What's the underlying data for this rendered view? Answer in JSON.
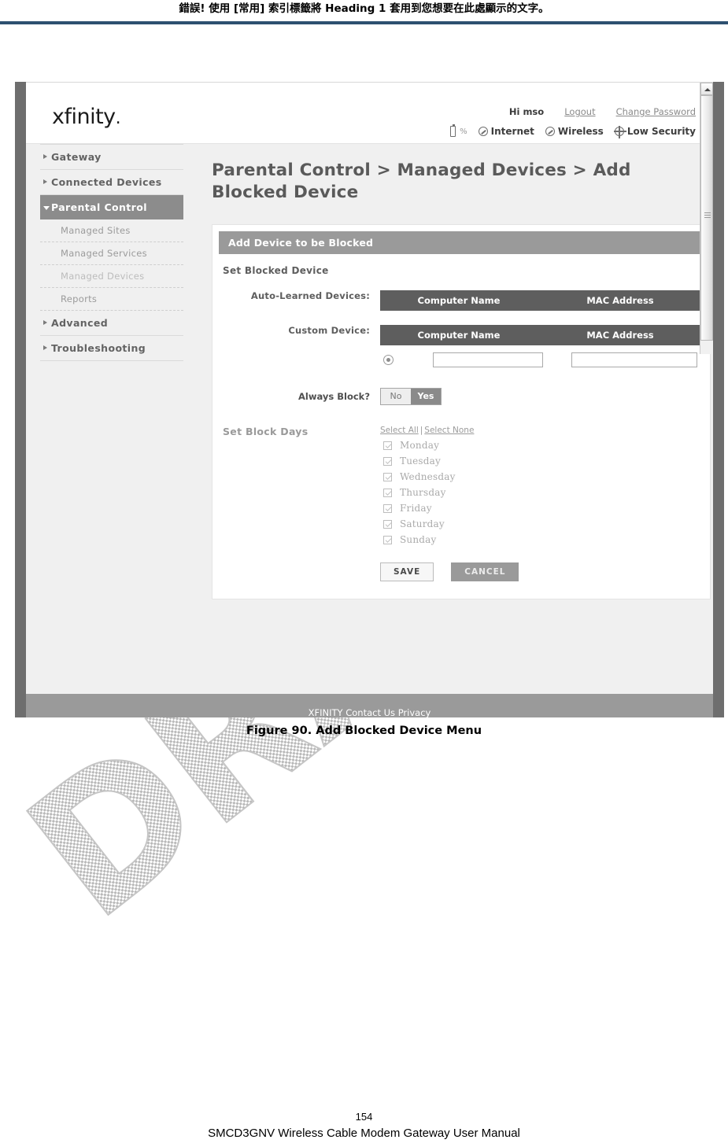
{
  "document": {
    "header_error_text": "錯誤! 使用 [常用] 索引標籤將 Heading 1 套用到您想要在此處顯示的文字。",
    "caption": "Figure 90. Add Blocked Device Menu",
    "page_number": "154",
    "footer_title": "SMCD3GNV Wireless Cable Modem Gateway User Manual",
    "watermark": "DRAFT",
    "header_rule_color": "#2e5070"
  },
  "app": {
    "brand": "xfinity",
    "account": {
      "greeting": "Hi mso",
      "logout": "Logout",
      "change_password": "Change Password"
    },
    "status": {
      "battery_percent": "%",
      "internet": "Internet",
      "wireless": "Wireless",
      "security": "Low Security"
    },
    "footer_text": "XFINITY            Contact Us   Privacy"
  },
  "sidebar": {
    "items": [
      {
        "label": "Gateway",
        "type": "top",
        "state": "collapsed"
      },
      {
        "label": "Connected Devices",
        "type": "top",
        "state": "collapsed"
      },
      {
        "label": "Parental Control",
        "type": "top",
        "state": "expanded",
        "active": true
      },
      {
        "label": "Managed Sites",
        "type": "sub"
      },
      {
        "label": "Managed Services",
        "type": "sub"
      },
      {
        "label": "Managed Devices",
        "type": "sub",
        "muted": true
      },
      {
        "label": "Reports",
        "type": "sub"
      },
      {
        "label": "Advanced",
        "type": "top",
        "state": "collapsed"
      },
      {
        "label": "Troubleshooting",
        "type": "top",
        "state": "collapsed"
      }
    ]
  },
  "main": {
    "page_title": "Parental Control > Managed Devices > Add Blocked Device",
    "card_title": "Add Device to be Blocked",
    "section_label": "Set Blocked Device",
    "auto_learned": {
      "label": "Auto-Learned Devices:",
      "columns": [
        "Computer Name",
        "MAC Address"
      ],
      "rows": []
    },
    "custom_device": {
      "label": "Custom Device:",
      "columns": [
        "Computer Name",
        "MAC Address"
      ],
      "row": {
        "selected": true,
        "computer_name": "",
        "mac_address": ""
      }
    },
    "always_block": {
      "label": "Always Block?",
      "options": [
        "No",
        "Yes"
      ],
      "selected": "Yes"
    },
    "block_days": {
      "title": "Set Block Days",
      "select_all": "Select All",
      "separator": "|",
      "select_none": "Select None",
      "days": [
        {
          "label": "Monday",
          "checked": true
        },
        {
          "label": "Tuesday",
          "checked": true
        },
        {
          "label": "Wednesday",
          "checked": true
        },
        {
          "label": "Thursday",
          "checked": true
        },
        {
          "label": "Friday",
          "checked": true
        },
        {
          "label": "Saturday",
          "checked": true
        },
        {
          "label": "Sunday",
          "checked": true
        }
      ]
    },
    "buttons": {
      "save": "SAVE",
      "cancel": "CANCEL"
    }
  }
}
